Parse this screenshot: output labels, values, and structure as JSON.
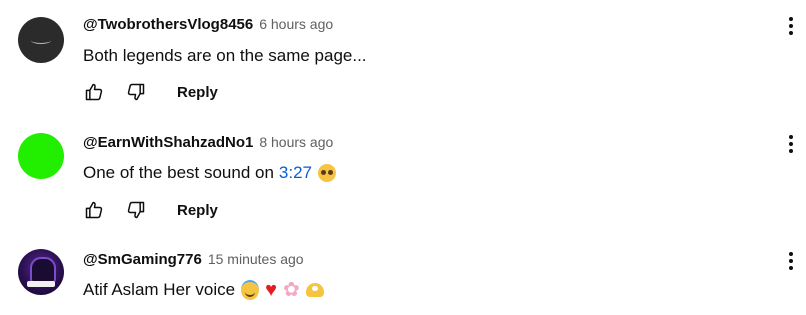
{
  "comments": [
    {
      "author": "@TwobrothersVlog8456",
      "time": "6 hours ago",
      "text": "Both legends are on the same page...",
      "avatar": "dark-logo-avatar",
      "reply_label": "Reply"
    },
    {
      "author": "@EarnWithShahzadNo1",
      "time": "8 hours ago",
      "text": "One of the best sound on",
      "timestamp_link": "3:27",
      "emojis": [
        "pleading-face-emoji"
      ],
      "avatar": "green-avatar",
      "reply_label": "Reply"
    },
    {
      "author": "@SmGaming776",
      "time": "15 minutes ago",
      "text": "Atif Aslam Her voice",
      "emojis": [
        "smiling-face-with-halo-emoji",
        "red-heart-emoji",
        "cherry-blossom-emoji",
        "heart-hands-emoji"
      ],
      "avatar": "purple-gaming-avatar"
    }
  ],
  "icons": {
    "like": "thumbs-up-icon",
    "dislike": "thumbs-down-icon",
    "menu": "more-vertical-icon"
  },
  "colors": {
    "text": "#0f0f0f",
    "secondary": "#606060",
    "link": "#065fd4",
    "green_avatar": "#22ee00"
  }
}
